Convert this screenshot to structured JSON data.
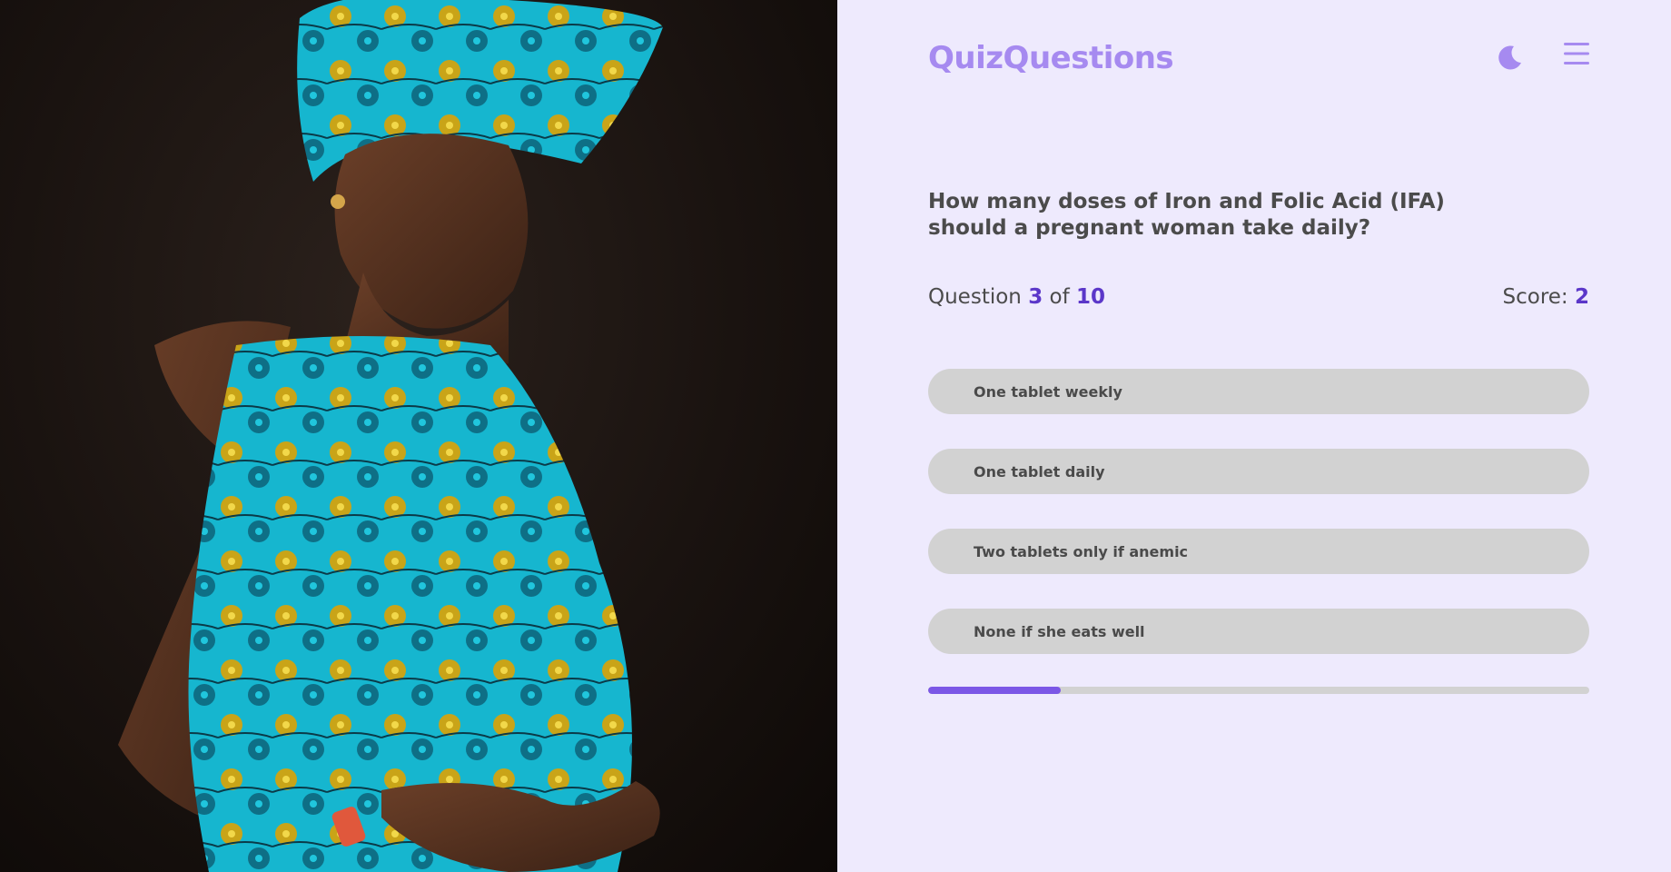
{
  "photo": {
    "subject": "pregnant woman in turquoise patterned wrap"
  },
  "header": {
    "brand": "QuizQuestions",
    "theme_toggle_icon": "moon-icon",
    "menu_icon": "hamburger-menu-icon"
  },
  "quiz": {
    "question": "How many doses of Iron and Folic Acid (IFA) should a pregnant woman take daily?",
    "question_label": "Question",
    "current": "3",
    "of_label": "of",
    "total": "10",
    "score_label": "Score:",
    "score": "2",
    "progress_fraction": 0.2,
    "answers": [
      {
        "label": "One tablet weekly"
      },
      {
        "label": "One tablet daily"
      },
      {
        "label": "Two tablets only if anemic"
      },
      {
        "label": "None if she eats well"
      }
    ]
  },
  "colors": {
    "brand": "#a68af0",
    "accent": "#5b37c9",
    "progress": "#7b57e6",
    "panel_bg": "#eeeafd",
    "answer_bg": "#d2d2d2"
  }
}
